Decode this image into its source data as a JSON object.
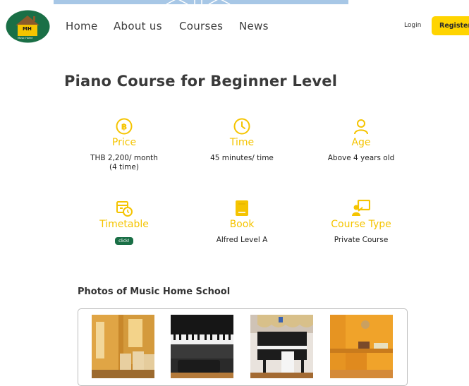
{
  "header": {
    "logo_text": "MH",
    "logo_subtext": "Music Home",
    "nav": [
      "Home",
      "About us",
      "Courses",
      "News"
    ],
    "login_label": "Login",
    "register_label": "Register"
  },
  "page": {
    "title": "Piano Course for Beginner Level"
  },
  "info": [
    {
      "icon": "baht-coin-icon",
      "label": "Price",
      "value": "THB 2,200/ month\n(4 time)"
    },
    {
      "icon": "clock-icon",
      "label": "Time",
      "value": "45 minutes/ time"
    },
    {
      "icon": "user-icon",
      "label": "Age",
      "value": "Above 4 years old"
    },
    {
      "icon": "calendar-clock-icon",
      "label": "Timetable",
      "button": "click!"
    },
    {
      "icon": "book-icon",
      "label": "Book",
      "value": "Alfred Level A"
    },
    {
      "icon": "teacher-board-icon",
      "label": "Course Type",
      "value": "Private Course"
    }
  ],
  "photos": {
    "title": "Photos of Music Home School"
  },
  "colors": {
    "accent": "#ffd400",
    "label_yellow": "#f5c400",
    "badge_green": "#1a6f46",
    "logo_green": "#1a6f46"
  }
}
